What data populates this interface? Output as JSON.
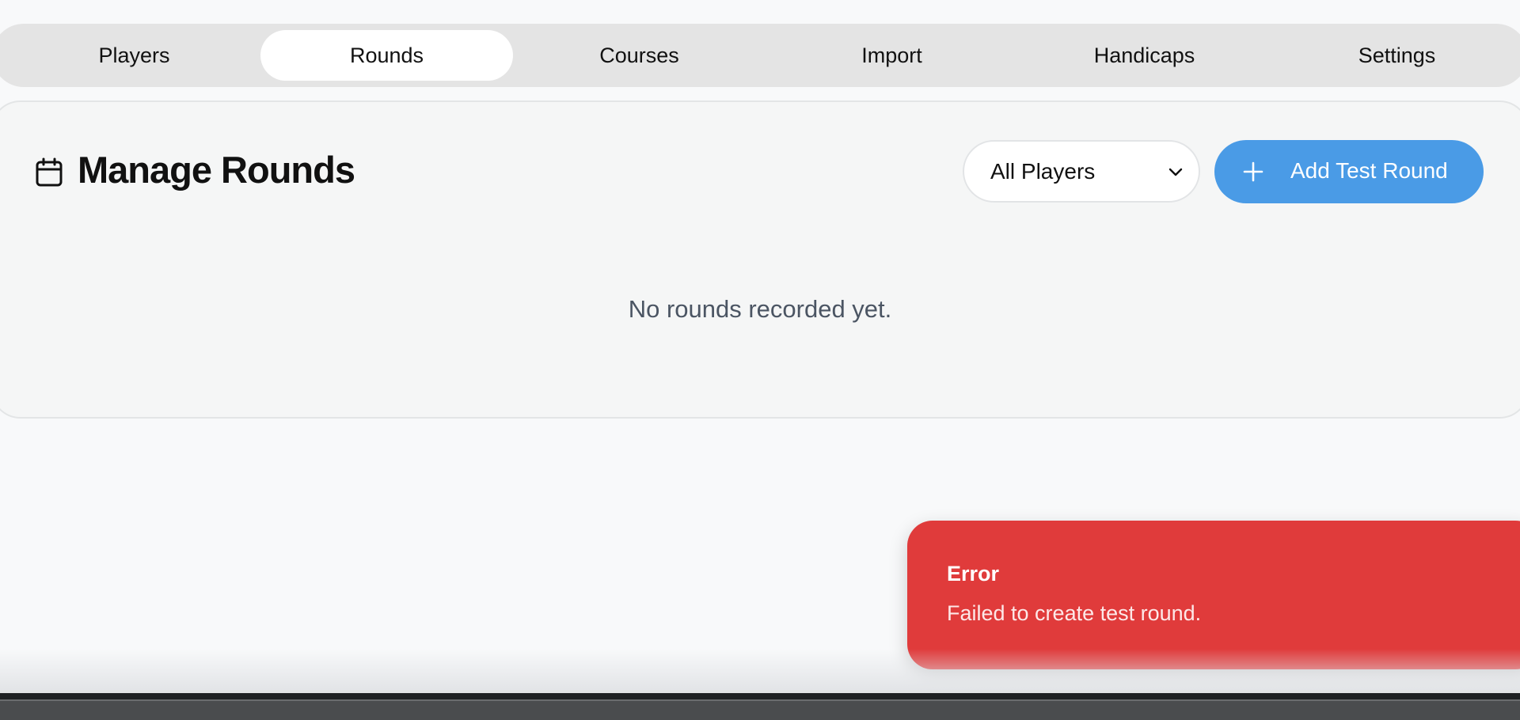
{
  "nav": {
    "tabs": [
      {
        "label": "Players"
      },
      {
        "label": "Rounds"
      },
      {
        "label": "Courses"
      },
      {
        "label": "Import"
      },
      {
        "label": "Handicaps"
      },
      {
        "label": "Settings"
      }
    ],
    "active_tab": "Rounds"
  },
  "rounds_panel": {
    "icon": "calendar-icon",
    "title": "Manage Rounds",
    "player_filter": {
      "selected": "All Players",
      "icon": "chevron-down-icon"
    },
    "add_button": {
      "icon": "plus-icon",
      "label": "Add Test Round"
    },
    "empty_message": "No rounds recorded yet."
  },
  "toast": {
    "title": "Error",
    "message": "Failed to create test round.",
    "color": "#e03b3b"
  },
  "colors": {
    "accent": "#4a9be6",
    "error": "#e03b3b",
    "tab_bar": "#e4e4e4"
  }
}
